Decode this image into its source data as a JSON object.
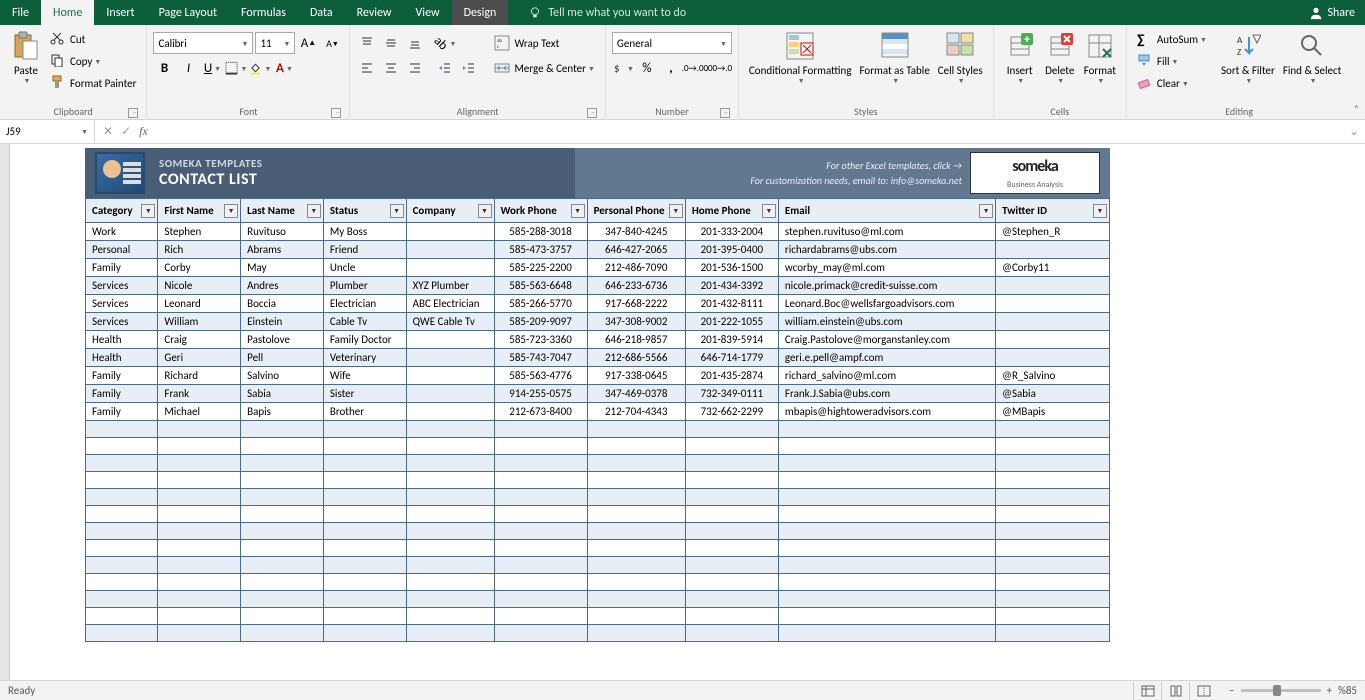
{
  "tabs": [
    "File",
    "Home",
    "Insert",
    "Page Layout",
    "Formulas",
    "Data",
    "Review",
    "View",
    "Design"
  ],
  "activeTab": "Home",
  "tellMe": "Tell me what you want to do",
  "share": "Share",
  "clipboard": {
    "paste": "Paste",
    "cut": "Cut",
    "copy": "Copy",
    "formatPainter": "Format Painter",
    "label": "Clipboard"
  },
  "font": {
    "name": "Calibri",
    "size": "11",
    "label": "Font"
  },
  "alignment": {
    "wrap": "Wrap Text",
    "merge": "Merge & Center",
    "label": "Alignment"
  },
  "number": {
    "format": "General",
    "label": "Number"
  },
  "styles": {
    "conditional": "Conditional Formatting",
    "formatAs": "Format as Table",
    "cell": "Cell Styles",
    "label": "Styles"
  },
  "cells": {
    "insert": "Insert",
    "delete": "Delete",
    "format": "Format",
    "label": "Cells"
  },
  "editing": {
    "autosum": "AutoSum",
    "fill": "Fill",
    "clear": "Clear",
    "sort": "Sort & Filter",
    "find": "Find & Select",
    "label": "Editing"
  },
  "namebox": "J59",
  "banner": {
    "sub": "SOMEKA TEMPLATES",
    "title": "CONTACT LIST",
    "r1": "For other Excel templates, click →",
    "r2": "For customization needs, email to: info@someka.net",
    "logo1": "someka",
    "logo2": "Business Analysis"
  },
  "headers": [
    "Category",
    "First Name",
    "Last Name",
    "Status",
    "Company",
    "Work Phone",
    "Personal Phone",
    "Home Phone",
    "Email",
    "Twitter ID"
  ],
  "rows": [
    [
      "Work",
      "Stephen",
      "Ruvituso",
      "My Boss",
      "",
      "585-288-3018",
      "347-840-4245",
      "201-333-2004",
      "stephen.ruvituso@ml.com",
      "@Stephen_R"
    ],
    [
      "Personal",
      "Rich",
      "Abrams",
      "Friend",
      "",
      "585-473-3757",
      "646-427-2065",
      "201-395-0400",
      "richardabrams@ubs.com",
      ""
    ],
    [
      "Family",
      "Corby",
      "May",
      "Uncle",
      "",
      "585-225-2200",
      "212-486-7090",
      "201-536-1500",
      "wcorby_may@ml.com",
      "@Corby11"
    ],
    [
      "Services",
      "Nicole",
      "Andres",
      "Plumber",
      "XYZ Plumber",
      "585-563-6648",
      "646-233-6736",
      "201-434-3392",
      "nicole.primack@credit-suisse.com",
      ""
    ],
    [
      "Services",
      "Leonard",
      "Boccia",
      "Electrician",
      "ABC Electrician",
      "585-266-5770",
      "917-668-2222",
      "201-432-8111",
      "Leonard.Boc@wellsfargoadvisors.com",
      ""
    ],
    [
      "Services",
      "William",
      "Einstein",
      "Cable Tv",
      "QWE Cable Tv",
      "585-209-9097",
      "347-308-9002",
      "201-222-1055",
      "william.einstein@ubs.com",
      ""
    ],
    [
      "Health",
      "Craig",
      "Pastolove",
      "Family Doctor",
      "",
      "585-723-3360",
      "646-218-9857",
      "201-839-5914",
      "Craig.Pastolove@morganstanley.com",
      ""
    ],
    [
      "Health",
      "Geri",
      "Pell",
      "Veterinary",
      "",
      "585-743-7047",
      "212-686-5566",
      "646-714-1779",
      "geri.e.pell@ampf.com",
      ""
    ],
    [
      "Family",
      "Richard",
      "Salvino",
      "Wife",
      "",
      "585-563-4776",
      "917-338-0645",
      "201-435-2874",
      "richard_salvino@ml.com",
      "@R_Salvino"
    ],
    [
      "Family",
      "Frank",
      "Sabia",
      "Sister",
      "",
      "914-255-0575",
      "347-469-0378",
      "732-349-0111",
      "Frank.J.Sabia@ubs.com",
      "@Sabia"
    ],
    [
      "Family",
      "Michael",
      "Bapis",
      "Brother",
      "",
      "212-673-8400",
      "212-704-4343",
      "732-662-2299",
      "mbapis@hightoweradvisors.com",
      "@MBapis"
    ]
  ],
  "emptyRows": 13,
  "status": {
    "ready": "Ready",
    "zoom": "%85"
  }
}
